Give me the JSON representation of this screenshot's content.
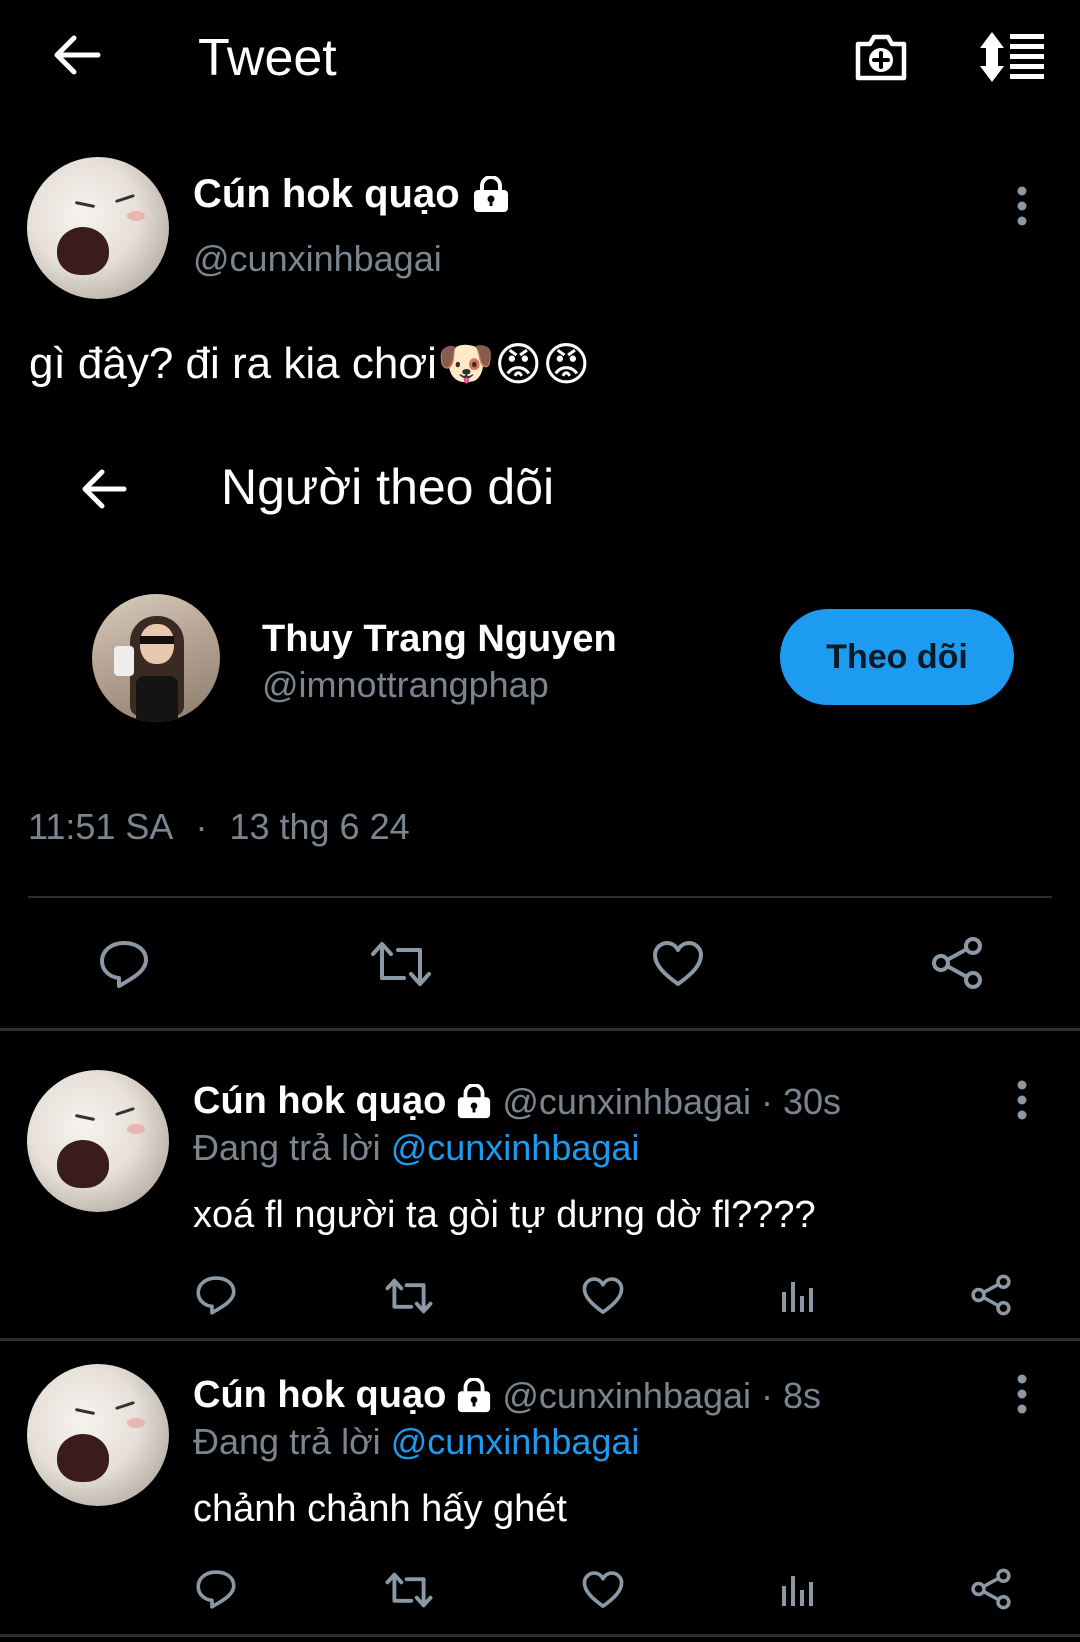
{
  "header": {
    "title": "Tweet"
  },
  "main_tweet": {
    "display_name": "Cún hok quạo",
    "handle": "@cunxinhbagai",
    "text": "gì đây? đi ra kia chơi",
    "emojis": [
      "🐶",
      "😡",
      "😡"
    ],
    "quoted_screen": {
      "title": "Người theo dõi",
      "user_name": "Thuy Trang Nguyen",
      "user_handle": "@imnottrangphap",
      "follow_label": "Theo dõi"
    },
    "time": "11:51 SA",
    "separator": "·",
    "date": "13 thg 6 24"
  },
  "replies": [
    {
      "display_name": "Cún hok quạo",
      "meta": "@cunxinhbagai · 30s",
      "replying_to_label": "Đang trả lời",
      "replying_to_handle": "@cunxinhbagai",
      "text": "xoá fl người ta gòi tự dưng dờ fl????"
    },
    {
      "display_name": "Cún hok quạo",
      "meta": "@cunxinhbagai · 8s",
      "replying_to_label": "Đang trả lời",
      "replying_to_handle": "@cunxinhbagai",
      "text": "chảnh chảnh hấy ghét"
    }
  ],
  "colors": {
    "background": "#000000",
    "accent": "#1d9bf0",
    "secondary_text": "#7a858f",
    "icon": "#8b98a5"
  }
}
